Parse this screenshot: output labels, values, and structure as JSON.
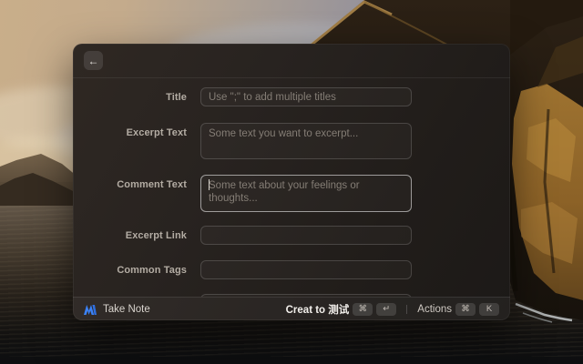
{
  "window": {
    "header": {
      "back_icon": "←"
    },
    "form": {
      "fields": [
        {
          "label": "Title",
          "placeholder": "Use \";\" to add multiple titles",
          "type": "input"
        },
        {
          "label": "Excerpt Text",
          "placeholder": "Some text you want to excerpt...",
          "type": "textarea"
        },
        {
          "label": "Comment Text",
          "placeholder": "Some text about your feelings or thoughts...",
          "type": "textarea",
          "focused": true
        },
        {
          "label": "Excerpt Link",
          "placeholder": "",
          "type": "input"
        },
        {
          "label": "Common Tags",
          "placeholder": "",
          "type": "input"
        },
        {
          "label": "",
          "placeholder": "",
          "type": "input",
          "partial": true
        }
      ]
    },
    "footer": {
      "app_name": "Take Note",
      "submit_label": "Creat to 测试",
      "submit_modifier_key": "⌘",
      "submit_enter_key": "↵",
      "actions_label": "Actions",
      "actions_modifier_key": "⌘",
      "actions_letter_key": "K"
    }
  },
  "colors": {
    "logo_blue": "#3b82f6",
    "window_bg": "#262120",
    "focus_border": "rgba(255,255,255,0.55)"
  }
}
